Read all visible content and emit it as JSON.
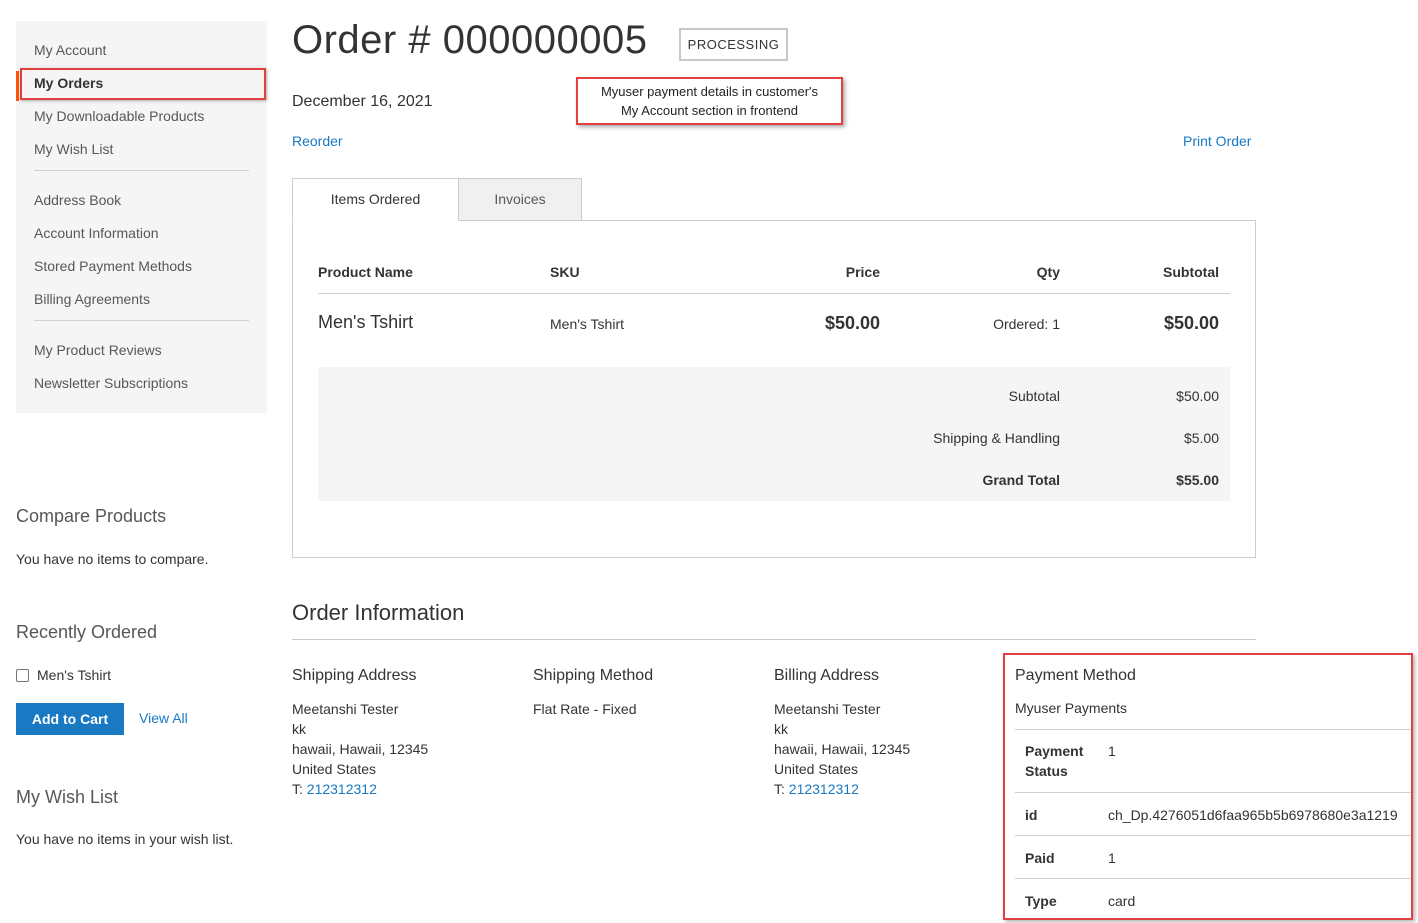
{
  "sidebar": {
    "nav": [
      {
        "label": "My Account"
      },
      {
        "label": "My Orders"
      },
      {
        "label": "My Downloadable Products"
      },
      {
        "label": "My Wish List"
      },
      {
        "label": "Address Book"
      },
      {
        "label": "Account Information"
      },
      {
        "label": "Stored Payment Methods"
      },
      {
        "label": "Billing Agreements"
      },
      {
        "label": "My Product Reviews"
      },
      {
        "label": "Newsletter Subscriptions"
      }
    ],
    "compare": {
      "title": "Compare Products",
      "empty": "You have no items to compare."
    },
    "recent": {
      "title": "Recently Ordered",
      "item": "Men's Tshirt",
      "add_to_cart": "Add to Cart",
      "view_all": "View All"
    },
    "wishlist": {
      "title": "My Wish List",
      "empty": "You have no items in your wish list."
    }
  },
  "order": {
    "title": "Order # 000000005",
    "status": "PROCESSING",
    "date": "December 16, 2021",
    "reorder": "Reorder",
    "print": "Print Order",
    "annotation_line1": "Myuser payment details in customer's",
    "annotation_line2": "My Account section in frontend",
    "tabs": [
      {
        "label": "Items Ordered"
      },
      {
        "label": "Invoices"
      }
    ],
    "columns": {
      "name": "Product Name",
      "sku": "SKU",
      "price": "Price",
      "qty": "Qty",
      "subtotal": "Subtotal"
    },
    "item": {
      "name": "Men's Tshirt",
      "sku": "Men's Tshirt",
      "price": "$50.00",
      "qty": "Ordered: 1",
      "subtotal": "$50.00"
    },
    "totals": {
      "subtotal_label": "Subtotal",
      "subtotal": "$50.00",
      "shipping_label": "Shipping & Handling",
      "shipping": "$5.00",
      "grand_label": "Grand Total",
      "grand": "$55.00"
    }
  },
  "info": {
    "title": "Order Information",
    "shipping_address": {
      "title": "Shipping Address",
      "name": "Meetanshi Tester",
      "line1": "kk",
      "line2": "hawaii, Hawaii, 12345",
      "country": "United States",
      "phone_prefix": "T: ",
      "phone": "212312312"
    },
    "shipping_method": {
      "title": "Shipping Method",
      "value": "Flat Rate - Fixed"
    },
    "billing_address": {
      "title": "Billing Address",
      "name": "Meetanshi Tester",
      "line1": "kk",
      "line2": "hawaii, Hawaii, 12345",
      "country": "United States",
      "phone_prefix": "T: ",
      "phone": "212312312"
    },
    "payment": {
      "title": "Payment Method",
      "method": "Myuser Payments",
      "status_key_1": "Payment",
      "status_key_2": "Status",
      "status_val": "1",
      "id_key": "id",
      "id_val": "ch_Dp.4276051d6faa965b5b6978680e3a1219",
      "paid_key": "Paid",
      "paid_val": "1",
      "type_key": "Type",
      "type_val": "card"
    }
  }
}
